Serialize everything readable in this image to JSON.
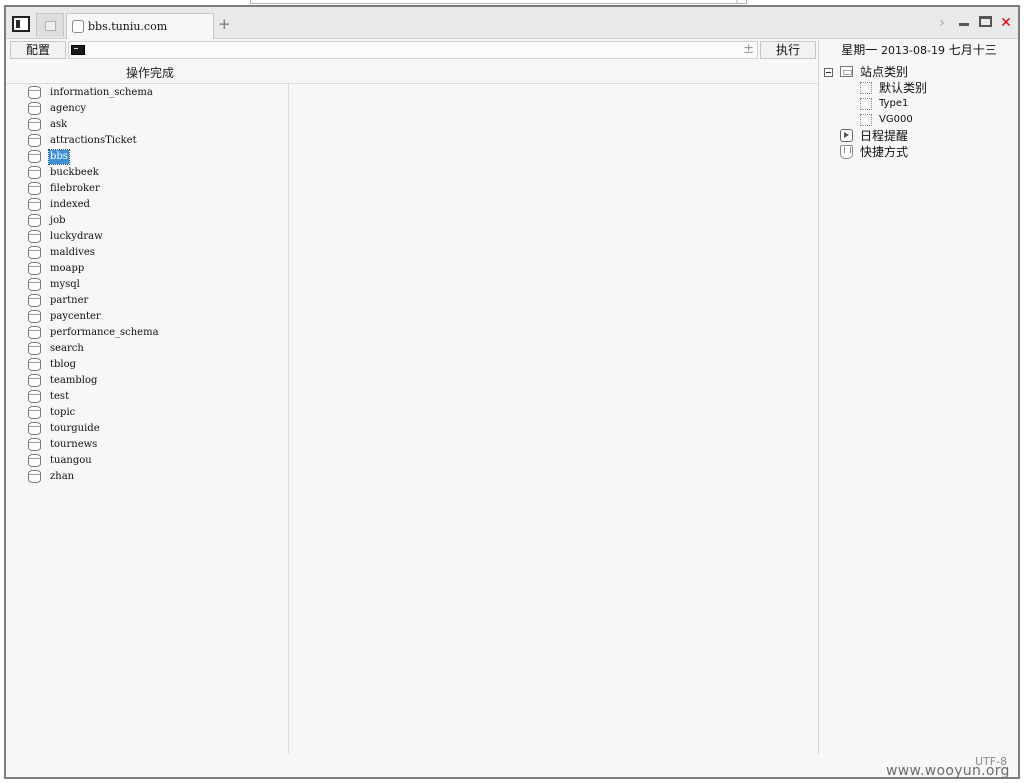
{
  "tabs": {
    "active_title": "bbs.tuniu.com",
    "new_tab_symbol": "+"
  },
  "window_controls": {
    "chevron": "›",
    "close": "✕"
  },
  "command_bar": {
    "config_label": "配置",
    "input_value": "",
    "input_side_symbol": "±",
    "execute_label": "执行"
  },
  "status": {
    "text": "操作完成"
  },
  "databases": [
    {
      "name": "information_schema",
      "selected": false
    },
    {
      "name": "agency",
      "selected": false
    },
    {
      "name": "ask",
      "selected": false
    },
    {
      "name": "attractionsTicket",
      "selected": false
    },
    {
      "name": "bbs",
      "selected": true
    },
    {
      "name": "buckbeek",
      "selected": false
    },
    {
      "name": "filebroker",
      "selected": false
    },
    {
      "name": "indexed",
      "selected": false
    },
    {
      "name": "job",
      "selected": false
    },
    {
      "name": "luckydraw",
      "selected": false
    },
    {
      "name": "maldives",
      "selected": false
    },
    {
      "name": "moapp",
      "selected": false
    },
    {
      "name": "mysql",
      "selected": false
    },
    {
      "name": "partner",
      "selected": false
    },
    {
      "name": "paycenter",
      "selected": false
    },
    {
      "name": "performance_schema",
      "selected": false
    },
    {
      "name": "search",
      "selected": false
    },
    {
      "name": "tblog",
      "selected": false
    },
    {
      "name": "teamblog",
      "selected": false
    },
    {
      "name": "test",
      "selected": false
    },
    {
      "name": "topic",
      "selected": false
    },
    {
      "name": "tourguide",
      "selected": false
    },
    {
      "name": "tournews",
      "selected": false
    },
    {
      "name": "tuangou",
      "selected": false
    },
    {
      "name": "zhan",
      "selected": false
    }
  ],
  "sidebar": {
    "weekday": "星期一",
    "date": "2013-08-19",
    "lunar": "七月十三",
    "site_category": {
      "label": "站点类别",
      "children": [
        "默认类别",
        "Type1",
        "VG000"
      ]
    },
    "schedule_label": "日程提醒",
    "shortcuts_label": "快捷方式"
  },
  "footer": {
    "encoding": "UTF-8",
    "watermark": "www.wooyun.org"
  },
  "colors": {
    "selection": "#3f8fd6",
    "close_red": "#e00000",
    "frame": "#7d7d7d"
  }
}
